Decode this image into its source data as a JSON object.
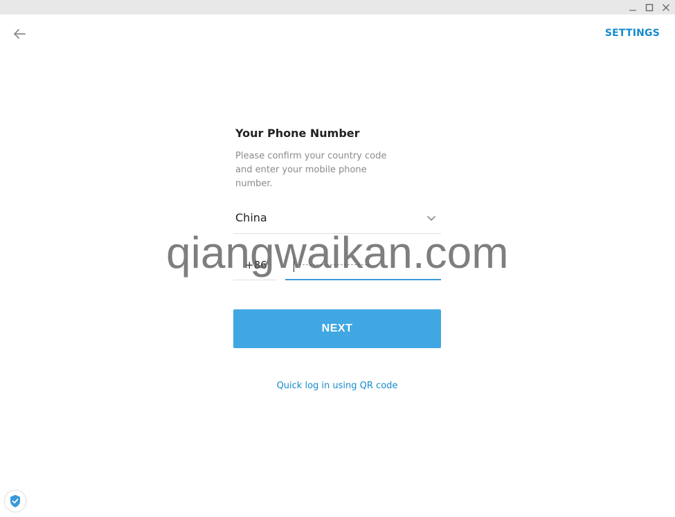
{
  "window": {
    "controls": [
      "minimize-icon",
      "maximize-icon",
      "close-icon"
    ]
  },
  "header": {
    "back_icon": "arrow-left-icon",
    "settings_label": "SETTINGS"
  },
  "login": {
    "title": "Your Phone Number",
    "description": "Please confirm your country code and enter your mobile phone number.",
    "country": {
      "selected": "China",
      "icon": "chevron-down-icon"
    },
    "country_code": "+86",
    "phone": {
      "value": "",
      "placeholder": ""
    },
    "next_label": "NEXT",
    "qr_link": "Quick log in using QR code"
  },
  "watermark": {
    "text": "qiangwaikan.com"
  },
  "status": {
    "shield_icon": "shield-check-icon"
  },
  "colors": {
    "accent": "#40a7e3",
    "link": "#168acd",
    "input_underline": "#3a9ad9",
    "titlebar": "#e8e8e8"
  }
}
